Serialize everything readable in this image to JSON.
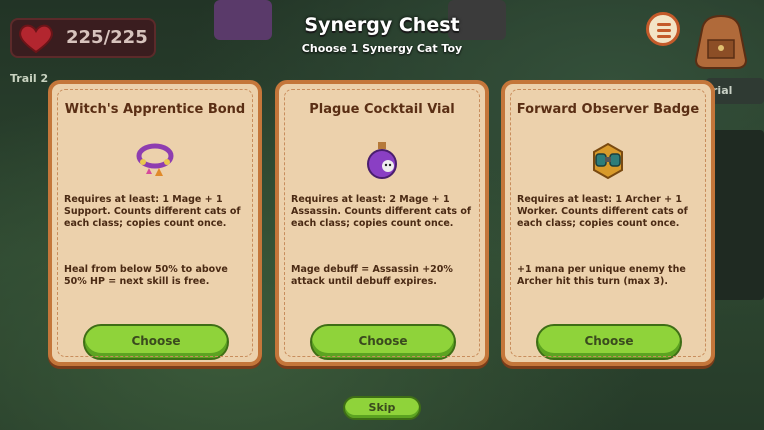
{
  "header": {
    "title": "Synergy Chest",
    "subtitle": "Choose 1 Synergy Cat Toy"
  },
  "hp": {
    "label": "225/225",
    "current": 225,
    "max": 225
  },
  "trail_label": "Trail 2",
  "background": {
    "tab_label": "rial"
  },
  "cards": [
    {
      "title": "Witch's Apprentice Bond",
      "icon": "charm-bracelet-icon",
      "requirement": "Requires at least: 1 Mage + 1 Support. Counts different cats of each class; copies count once.",
      "effect": "Heal from below 50% to above 50% HP = next skill is free.",
      "button": "Choose"
    },
    {
      "title": "Plague Cocktail Vial",
      "icon": "poison-vial-icon",
      "requirement": "Requires at least: 2 Mage + 1 Assassin. Counts different cats of each class; copies count once.",
      "effect": "Mage debuff = Assassin +20% attack until debuff expires.",
      "button": "Choose"
    },
    {
      "title": "Forward Observer Badge",
      "icon": "binoculars-badge-icon",
      "requirement": "Requires at least: 1 Archer + 1 Worker. Counts different cats of each class; copies count once.",
      "effect": "+1 mana per unique enemy the Archer hit this turn (max 3).",
      "button": "Choose"
    }
  ],
  "skip_label": "Skip",
  "colors": {
    "card_bg": "#ecd1ac",
    "card_border": "#c4763a",
    "button_green": "#8fd33a"
  }
}
